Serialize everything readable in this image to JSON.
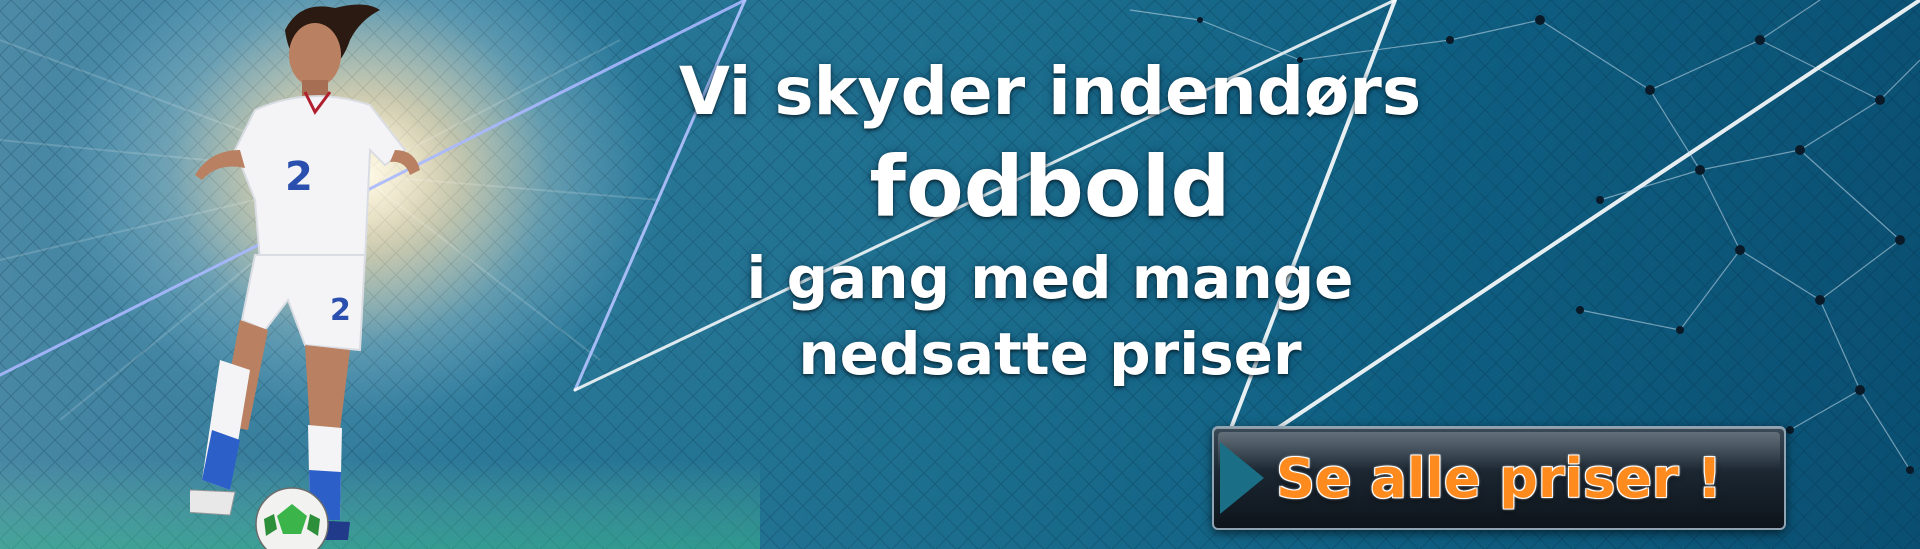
{
  "banner": {
    "headline": {
      "line1": "Vi skyder indendørs",
      "line2": "fodbold",
      "line3": "i gang med mange",
      "line4": "nedsatte priser"
    },
    "cta_label": "Se alle priser !"
  },
  "icons": {
    "player": "soccer-player-illustration",
    "ball": "soccer-ball-icon",
    "arrow": "play-arrow-icon"
  },
  "colors": {
    "background": "#1d6f8f",
    "headline_text": "#ffffff",
    "cta_text": "#ff8a1e",
    "cta_button": "#1b2631"
  }
}
